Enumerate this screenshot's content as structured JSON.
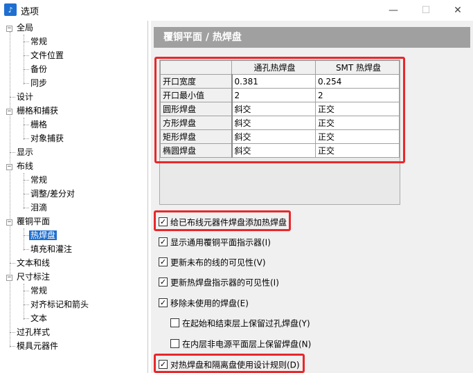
{
  "window": {
    "icon_glyph": "♪",
    "title": "选项",
    "minimize_glyph": "—",
    "maximize_glyph": "☐",
    "close_glyph": "✕"
  },
  "tree": {
    "items": [
      {
        "label": "全局"
      },
      {
        "label": "常规"
      },
      {
        "label": "文件位置"
      },
      {
        "label": "备份"
      },
      {
        "label": "同步"
      },
      {
        "label": "设计"
      },
      {
        "label": "栅格和捕获"
      },
      {
        "label": "栅格"
      },
      {
        "label": "对象捕获"
      },
      {
        "label": "显示"
      },
      {
        "label": "布线"
      },
      {
        "label": "常规"
      },
      {
        "label": "调整/差分对"
      },
      {
        "label": "泪滴"
      },
      {
        "label": "覆铜平面"
      },
      {
        "label": "热焊盘"
      },
      {
        "label": "填充和灌注"
      },
      {
        "label": "文本和线"
      },
      {
        "label": "尺寸标注"
      },
      {
        "label": "常规"
      },
      {
        "label": "对齐标记和箭头"
      },
      {
        "label": "文本"
      },
      {
        "label": "过孔样式"
      },
      {
        "label": "模具元器件"
      }
    ],
    "selected_index": 15
  },
  "panel": {
    "header": "覆铜平面 / 热焊盘",
    "grid": {
      "columns": [
        "通孔热焊盘",
        "SMT 热焊盘"
      ],
      "rows": [
        {
          "label": "开口宽度",
          "values": [
            "0.381",
            "0.254"
          ]
        },
        {
          "label": "开口最小值",
          "values": [
            "2",
            "2"
          ]
        },
        {
          "label": "圆形焊盘",
          "values": [
            "斜交",
            "正交"
          ]
        },
        {
          "label": "方形焊盘",
          "values": [
            "斜交",
            "正交"
          ]
        },
        {
          "label": "矩形焊盘",
          "values": [
            "斜交",
            "正交"
          ]
        },
        {
          "label": "椭圆焊盘",
          "values": [
            "斜交",
            "正交"
          ]
        }
      ]
    },
    "checks": [
      {
        "label": "给已布线元器件焊盘添加热焊盘",
        "checked": true
      },
      {
        "label": "显示通用覆铜平面指示器(I)",
        "checked": true
      },
      {
        "label": "更新未布的线的可见性(V)",
        "checked": true
      },
      {
        "label": "更新热焊盘指示器的可见性(I)",
        "checked": true
      },
      {
        "label": "移除未使用的焊盘(E)",
        "checked": true
      },
      {
        "label": "在起始和结束层上保留过孔焊盘(Y)",
        "checked": false
      },
      {
        "label": "在内层非电源平面层上保留焊盘(N)",
        "checked": false
      },
      {
        "label": "对热焊盘和隔离盘使用设计规则(D)",
        "checked": true
      }
    ],
    "check_mark": "✓",
    "highlight_color": "#e8272b",
    "selection_color": "#1e6fd0"
  }
}
